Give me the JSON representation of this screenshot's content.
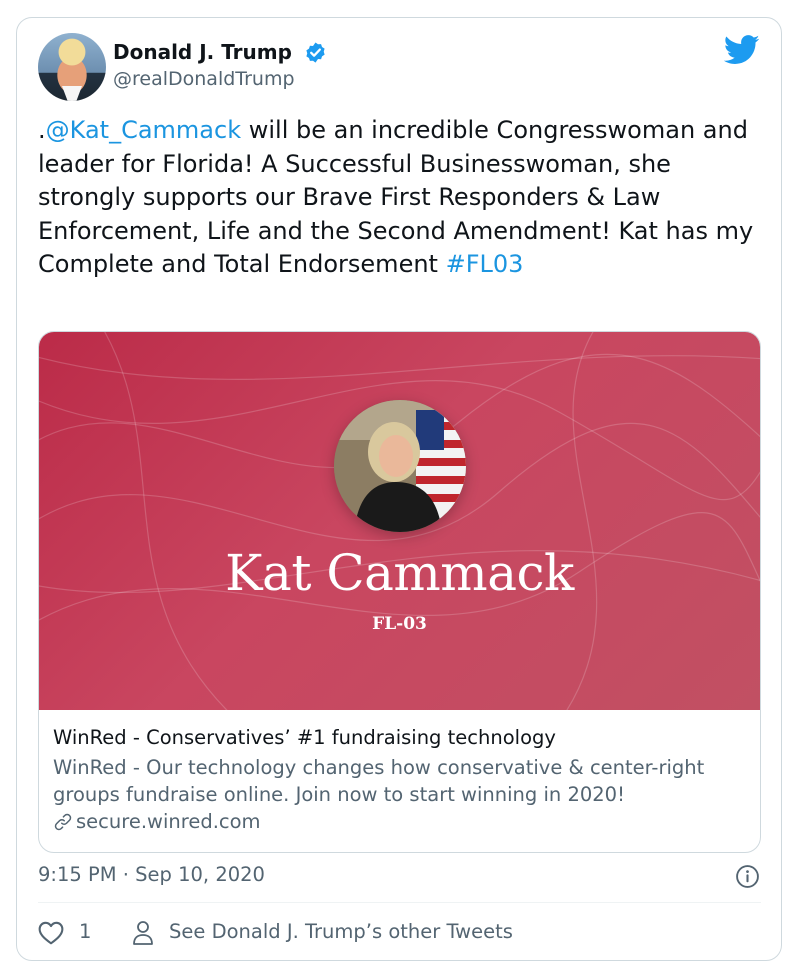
{
  "tweet": {
    "author": {
      "name": "Donald J. Trump",
      "handle": "@realDonaldTrump",
      "avatar_icon": "profile-photo"
    },
    "text_segments": {
      "prefix": ".",
      "mention": "@Kat_Cammack",
      "body": " will be an incredible Congresswoman and leader for Florida! A Successful Businesswoman, she strongly supports our Brave First Responders & Law Enforcement, Life and the Second Amendment! Kat has my Complete and Total Endorsement ",
      "hashtag": "#FL03"
    },
    "card": {
      "image_name": "Kat Cammack",
      "image_district": "FL-03",
      "title": "WinRed - Conservatives’ #1 fundraising technology",
      "description": "WinRed - Our technology changes how conservative & center-right groups fundraise online. Join now to start winning in 2020!",
      "domain": "secure.winred.com"
    },
    "timestamp": "9:15 PM · Sep 10, 2020",
    "likes": "1",
    "other_tweets_label": "See Donald J. Trump’s other Tweets"
  },
  "colors": {
    "link": "#1b95e0",
    "secondary_text": "#536471",
    "verified": "#1d9bf0",
    "card_background": "#c23d57"
  }
}
